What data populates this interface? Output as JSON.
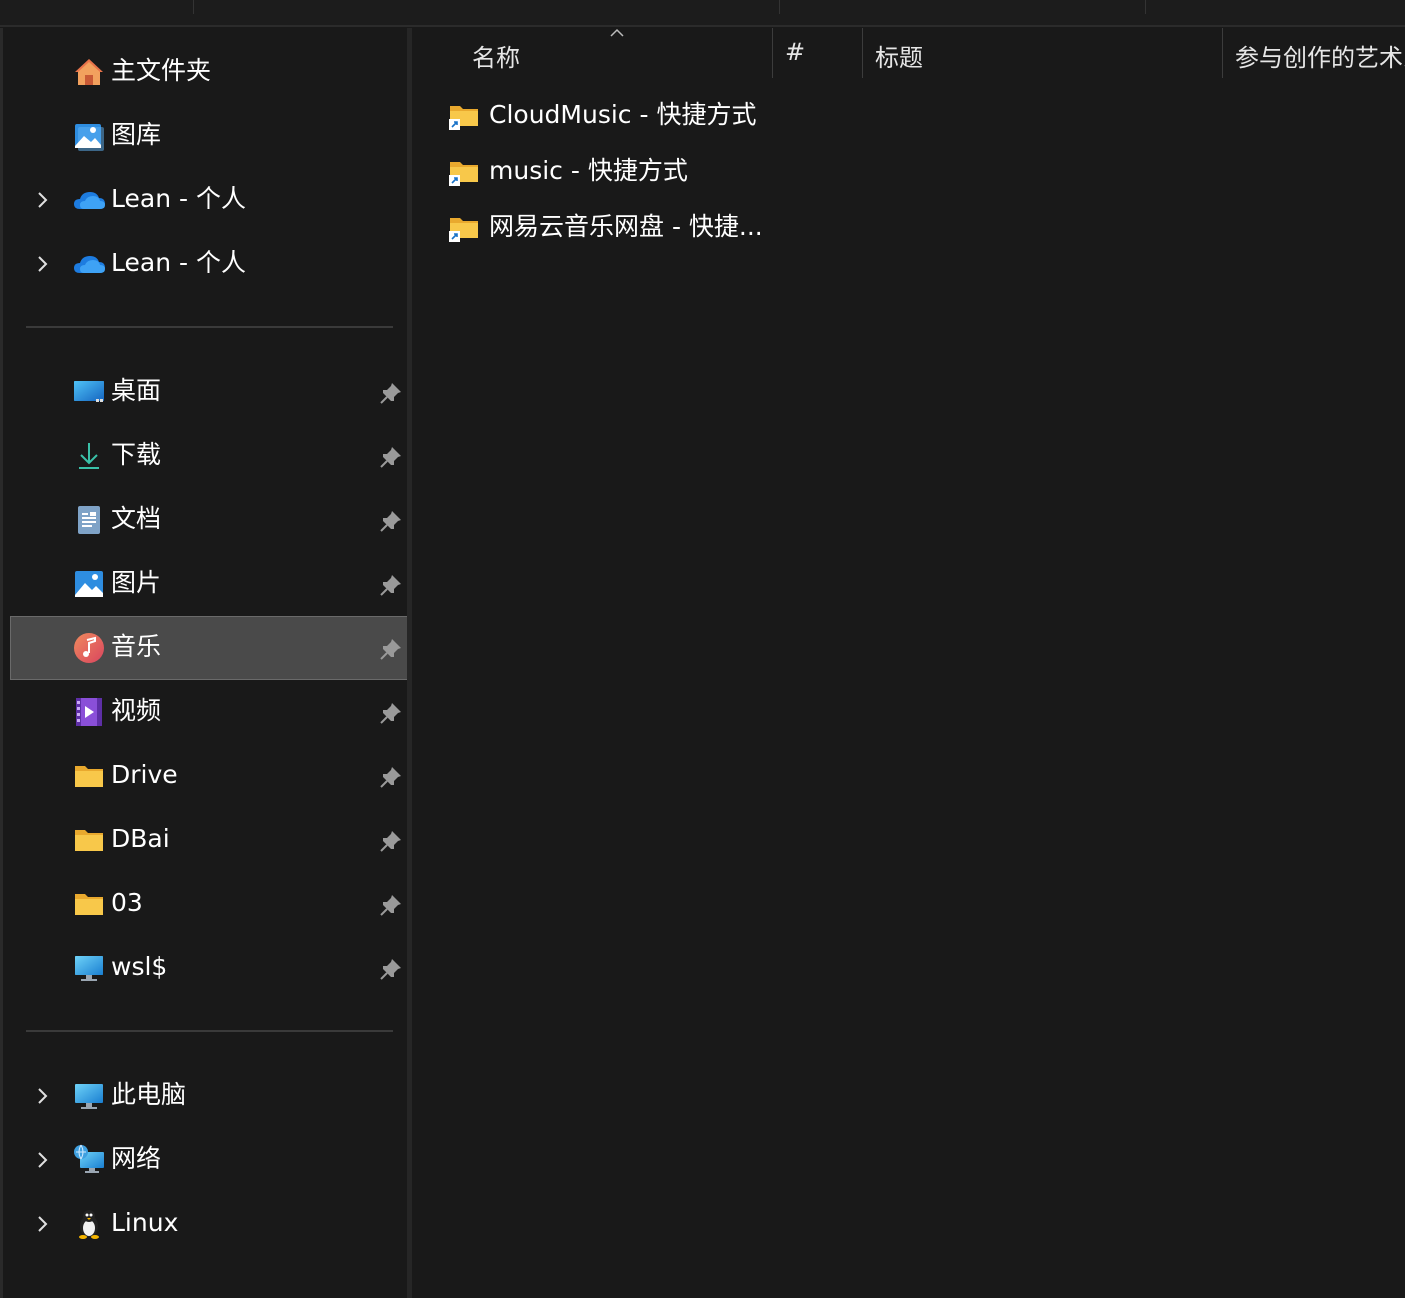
{
  "nav": {
    "quick": [
      {
        "label": "主文件夹",
        "icon": "home-icon",
        "expandable": false
      },
      {
        "label": "图库",
        "icon": "gallery-icon",
        "expandable": false
      },
      {
        "label": "Lean - 个人",
        "icon": "onedrive-cloud-icon",
        "expandable": true
      },
      {
        "label": "Lean - 个人",
        "icon": "onedrive-cloud-icon",
        "expandable": true
      }
    ],
    "pinned": [
      {
        "label": "桌面",
        "icon": "desktop-icon",
        "pinned": true
      },
      {
        "label": "下载",
        "icon": "download-icon",
        "pinned": true
      },
      {
        "label": "文档",
        "icon": "document-icon",
        "pinned": true
      },
      {
        "label": "图片",
        "icon": "pictures-icon",
        "pinned": true
      },
      {
        "label": "音乐",
        "icon": "music-icon",
        "pinned": true,
        "selected": true
      },
      {
        "label": "视频",
        "icon": "video-icon",
        "pinned": true
      },
      {
        "label": "Drive",
        "icon": "folder-icon",
        "pinned": true
      },
      {
        "label": "DBai",
        "icon": "folder-icon",
        "pinned": true
      },
      {
        "label": "03",
        "icon": "folder-icon",
        "pinned": true
      },
      {
        "label": "wsl$",
        "icon": "monitor-icon",
        "pinned": true
      }
    ],
    "system": [
      {
        "label": "此电脑",
        "icon": "this-pc-icon",
        "expandable": true
      },
      {
        "label": "网络",
        "icon": "network-icon",
        "expandable": true
      },
      {
        "label": "Linux",
        "icon": "linux-penguin-icon",
        "expandable": true
      }
    ]
  },
  "columns": {
    "name": "名称",
    "number": "#",
    "title": "标题",
    "artists": "参与创作的艺术家"
  },
  "sort": {
    "column": "name",
    "direction": "ascending"
  },
  "files": [
    {
      "name": "CloudMusic - 快捷方式",
      "icon": "folder-shortcut-icon"
    },
    {
      "name": "music - 快捷方式",
      "icon": "folder-shortcut-icon"
    },
    {
      "name": "网易云音乐网盘 - 快捷...",
      "icon": "folder-shortcut-icon"
    }
  ],
  "colors": {
    "background": "#191919",
    "selection": "#4a4a4a",
    "folder": "#f8c84a"
  }
}
